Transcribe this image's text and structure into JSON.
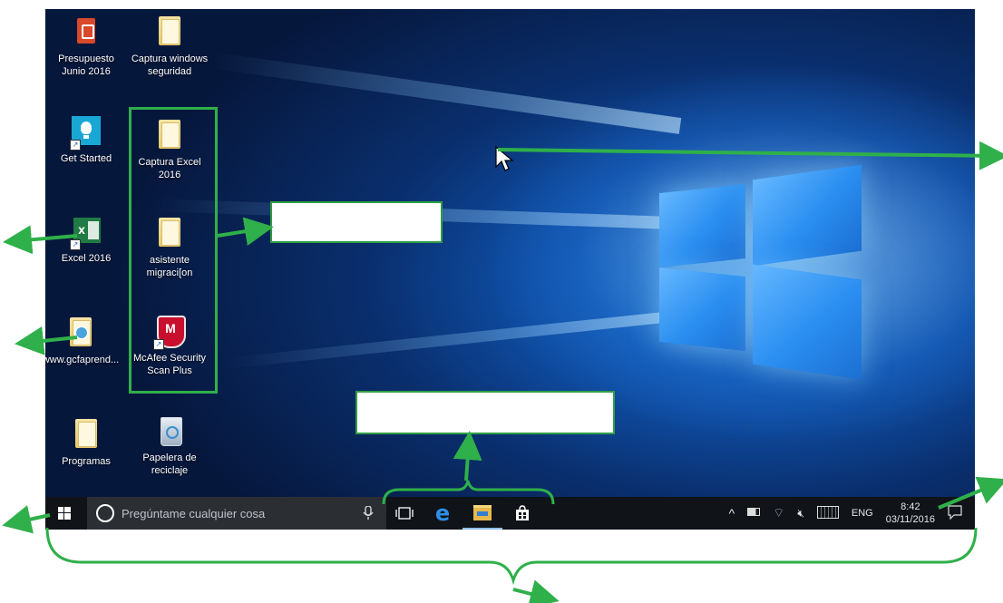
{
  "desktop_icons": [
    {
      "label": "Presupuesto Junio 2016",
      "icon": "pdf-document-icon"
    },
    {
      "label": "Captura windows seguridad",
      "icon": "folder-icon"
    },
    {
      "label": "Get Started",
      "icon": "lightbulb-icon"
    },
    {
      "label": "Captura Excel 2016",
      "icon": "folder-icon"
    },
    {
      "label": "Excel 2016",
      "icon": "excel-icon"
    },
    {
      "label": "asistente migraci[on",
      "icon": "folder-icon"
    },
    {
      "label": "www.gcfaprend...",
      "icon": "web-folder-icon"
    },
    {
      "label": "McAfee Security Scan Plus",
      "icon": "mcafee-shield-icon"
    },
    {
      "label": "Programas",
      "icon": "folder-icon"
    },
    {
      "label": "Papelera de reciclaje",
      "icon": "recycle-bin-icon"
    }
  ],
  "taskbar": {
    "search_placeholder": "Pregúntame cualquier cosa",
    "language": "ENG",
    "time": "8:42",
    "date": "03/11/2016"
  },
  "colors": {
    "annotation_green": "#2fb04a",
    "taskbar_bg": "#101318",
    "wallpaper_blue": "#1b78d8"
  }
}
